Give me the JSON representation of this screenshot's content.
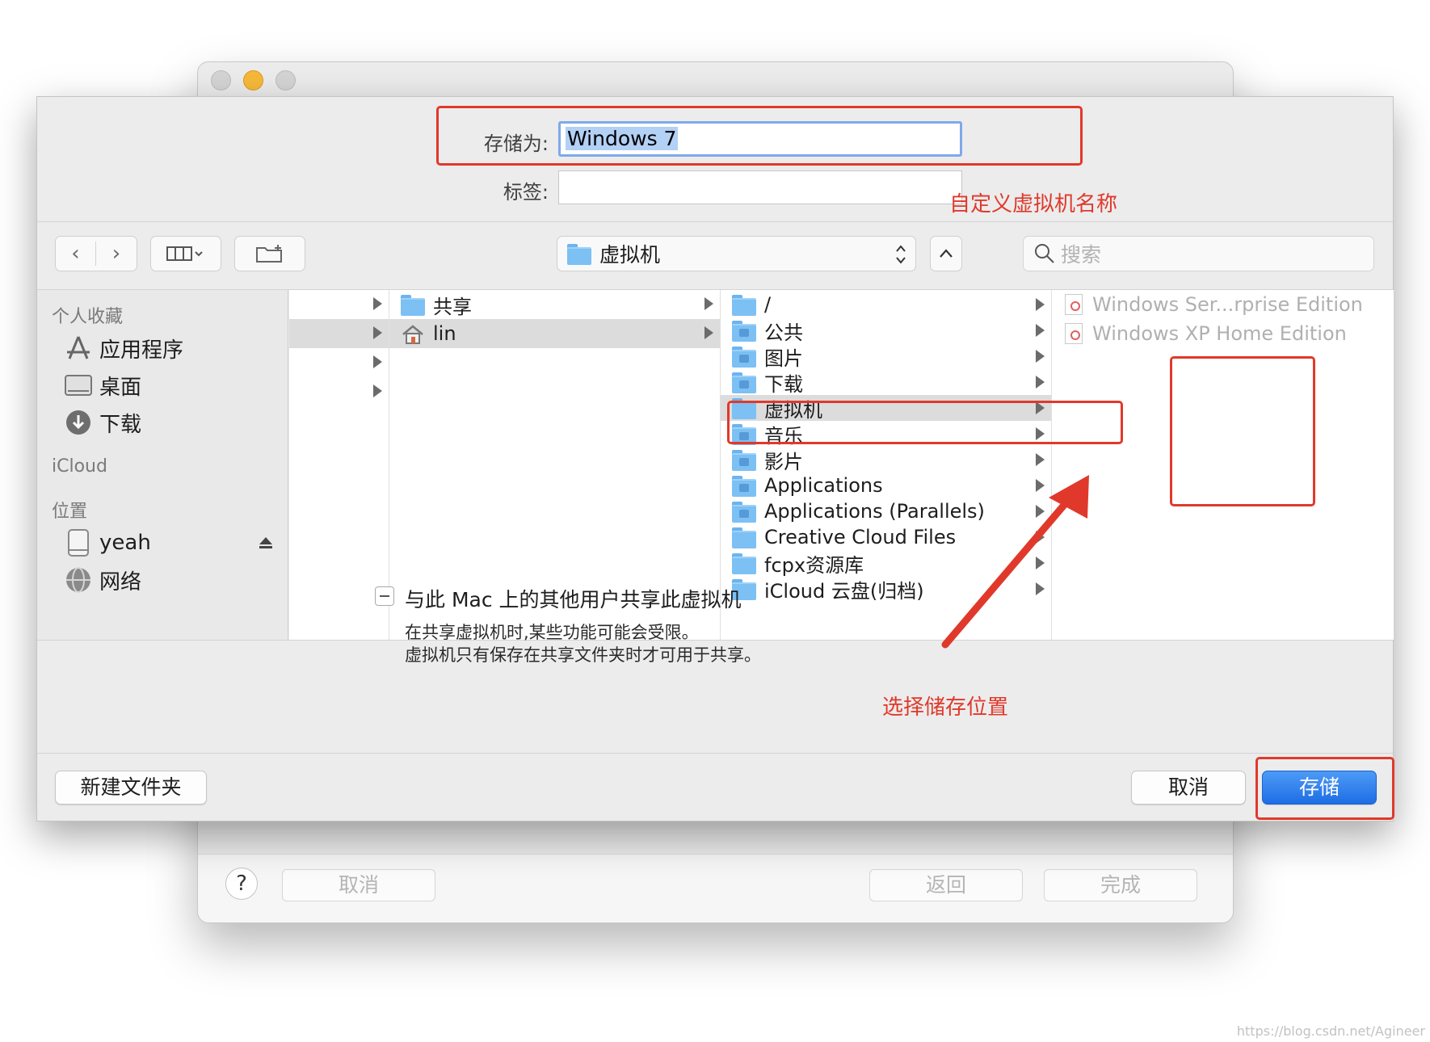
{
  "background_window": {
    "help_label": "?",
    "cancel_label": "取消",
    "back_label": "返回",
    "done_label": "完成"
  },
  "save_dialog": {
    "save_as_label": "存储为:",
    "save_as_value": "Windows 7",
    "tags_label": "标签:",
    "location": "虚拟机",
    "search_placeholder": "搜索",
    "sidebar": {
      "favorites_header": "个人收藏",
      "favorites": [
        "应用程序",
        "桌面",
        "下载"
      ],
      "icloud_header": "iCloud",
      "locations_header": "位置",
      "locations": [
        "yeah",
        "网络"
      ]
    },
    "column2": [
      "共享",
      "lin"
    ],
    "column3": [
      "/",
      "公共",
      "图片",
      "下载",
      "虚拟机",
      "音乐",
      "影片",
      "Applications",
      "Applications (Parallels)",
      "Creative Cloud Files",
      "fcpx资源库",
      "iCloud 云盘(归档)"
    ],
    "column4": [
      "Windows Ser...rprise Edition",
      "Windows XP Home Edition"
    ],
    "share_option": "与此 Mac 上的其他用户共享此虚拟机",
    "share_note_1": "在共享虚拟机时,某些功能可能会受限。",
    "share_note_2": "虚拟机只有保存在共享文件夹时才可用于共享。",
    "new_folder_label": "新建文件夹",
    "cancel_label": "取消",
    "save_label": "存储"
  },
  "annotations": {
    "name_note": "自定义虚拟机名称",
    "location_note": "选择储存位置",
    "color": "#e0392b"
  },
  "watermark": "https://blog.csdn.net/Agineer"
}
